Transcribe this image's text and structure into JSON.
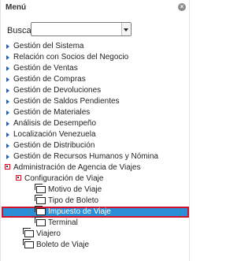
{
  "header": {
    "title": "Menú",
    "close_symbol": "×",
    "close_icon": "close-icon"
  },
  "search": {
    "label": "Buscar:",
    "value": ""
  },
  "tree": {
    "top_items": [
      "Gestión del Sistema",
      "Relación con Socios del Negocio",
      "Gestión de Ventas",
      "Gestión de Compras",
      "Gestión de Devoluciones",
      "Gestión de Saldos Pendientes",
      "Gestión de Materiales",
      "Análisis de Desempeño",
      "Localización Venezuela",
      "Gestión de Distribución",
      "Gestión de Recursos Humanos y Nómina"
    ],
    "expanded_item": "Administración de Agencia de Viajes",
    "sub_expanded_item": "Configuración de Viaje",
    "config_children": [
      "Motivo de Viaje",
      "Tipo de Boleto",
      "Impuesto de Viaje",
      "Terminal"
    ],
    "selected_child": "Impuesto de Viaje",
    "other_children": [
      "Viajero",
      "Boleto de Viaje"
    ]
  },
  "colors": {
    "accent_blue": "#2c5fa8",
    "selection_bg": "#2a8fd6",
    "highlight_border": "#d0122b"
  }
}
